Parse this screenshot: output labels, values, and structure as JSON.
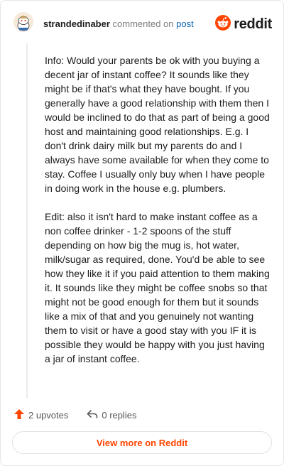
{
  "header": {
    "username": "strandedinaber",
    "commented_on": "commented on",
    "post_link": "post",
    "brand": "reddit"
  },
  "comment": {
    "paragraphs": [
      "Info: Would your parents be ok with you buying a decent jar of instant coffee? It sounds like they might be if that's what they have bought. If you generally have a good relationship with them then I would be inclined to do that as part of being a good host and maintaining good relationships. E.g. I don't drink dairy milk but my parents do and I always have some available for when they come to stay. Coffee I usually only buy when I have people in doing work in the house e.g. plumbers.",
      "Edit: also it isn't hard to make instant coffee as a non coffee drinker - 1-2 spoons of the stuff depending on how big the mug is, hot water, milk/sugar as required, done. You'd be able to see how they like it if you paid attention to them making it. It sounds like they might be coffee snobs so that might not be good enough for them but it sounds like a mix of that and you genuinely not wanting them to visit or have a good stay with you IF it is possible they would be happy with you just having a jar of instant coffee."
    ]
  },
  "actions": {
    "upvotes": "2 upvotes",
    "replies": "0 replies"
  },
  "footer": {
    "view_more": "View more on Reddit"
  },
  "colors": {
    "accent": "#ff4500",
    "link": "#0e67b5"
  },
  "icons": [
    "snoo-avatar-icon",
    "reddit-logo-icon",
    "upvote-arrow-icon",
    "reply-arrow-icon"
  ]
}
